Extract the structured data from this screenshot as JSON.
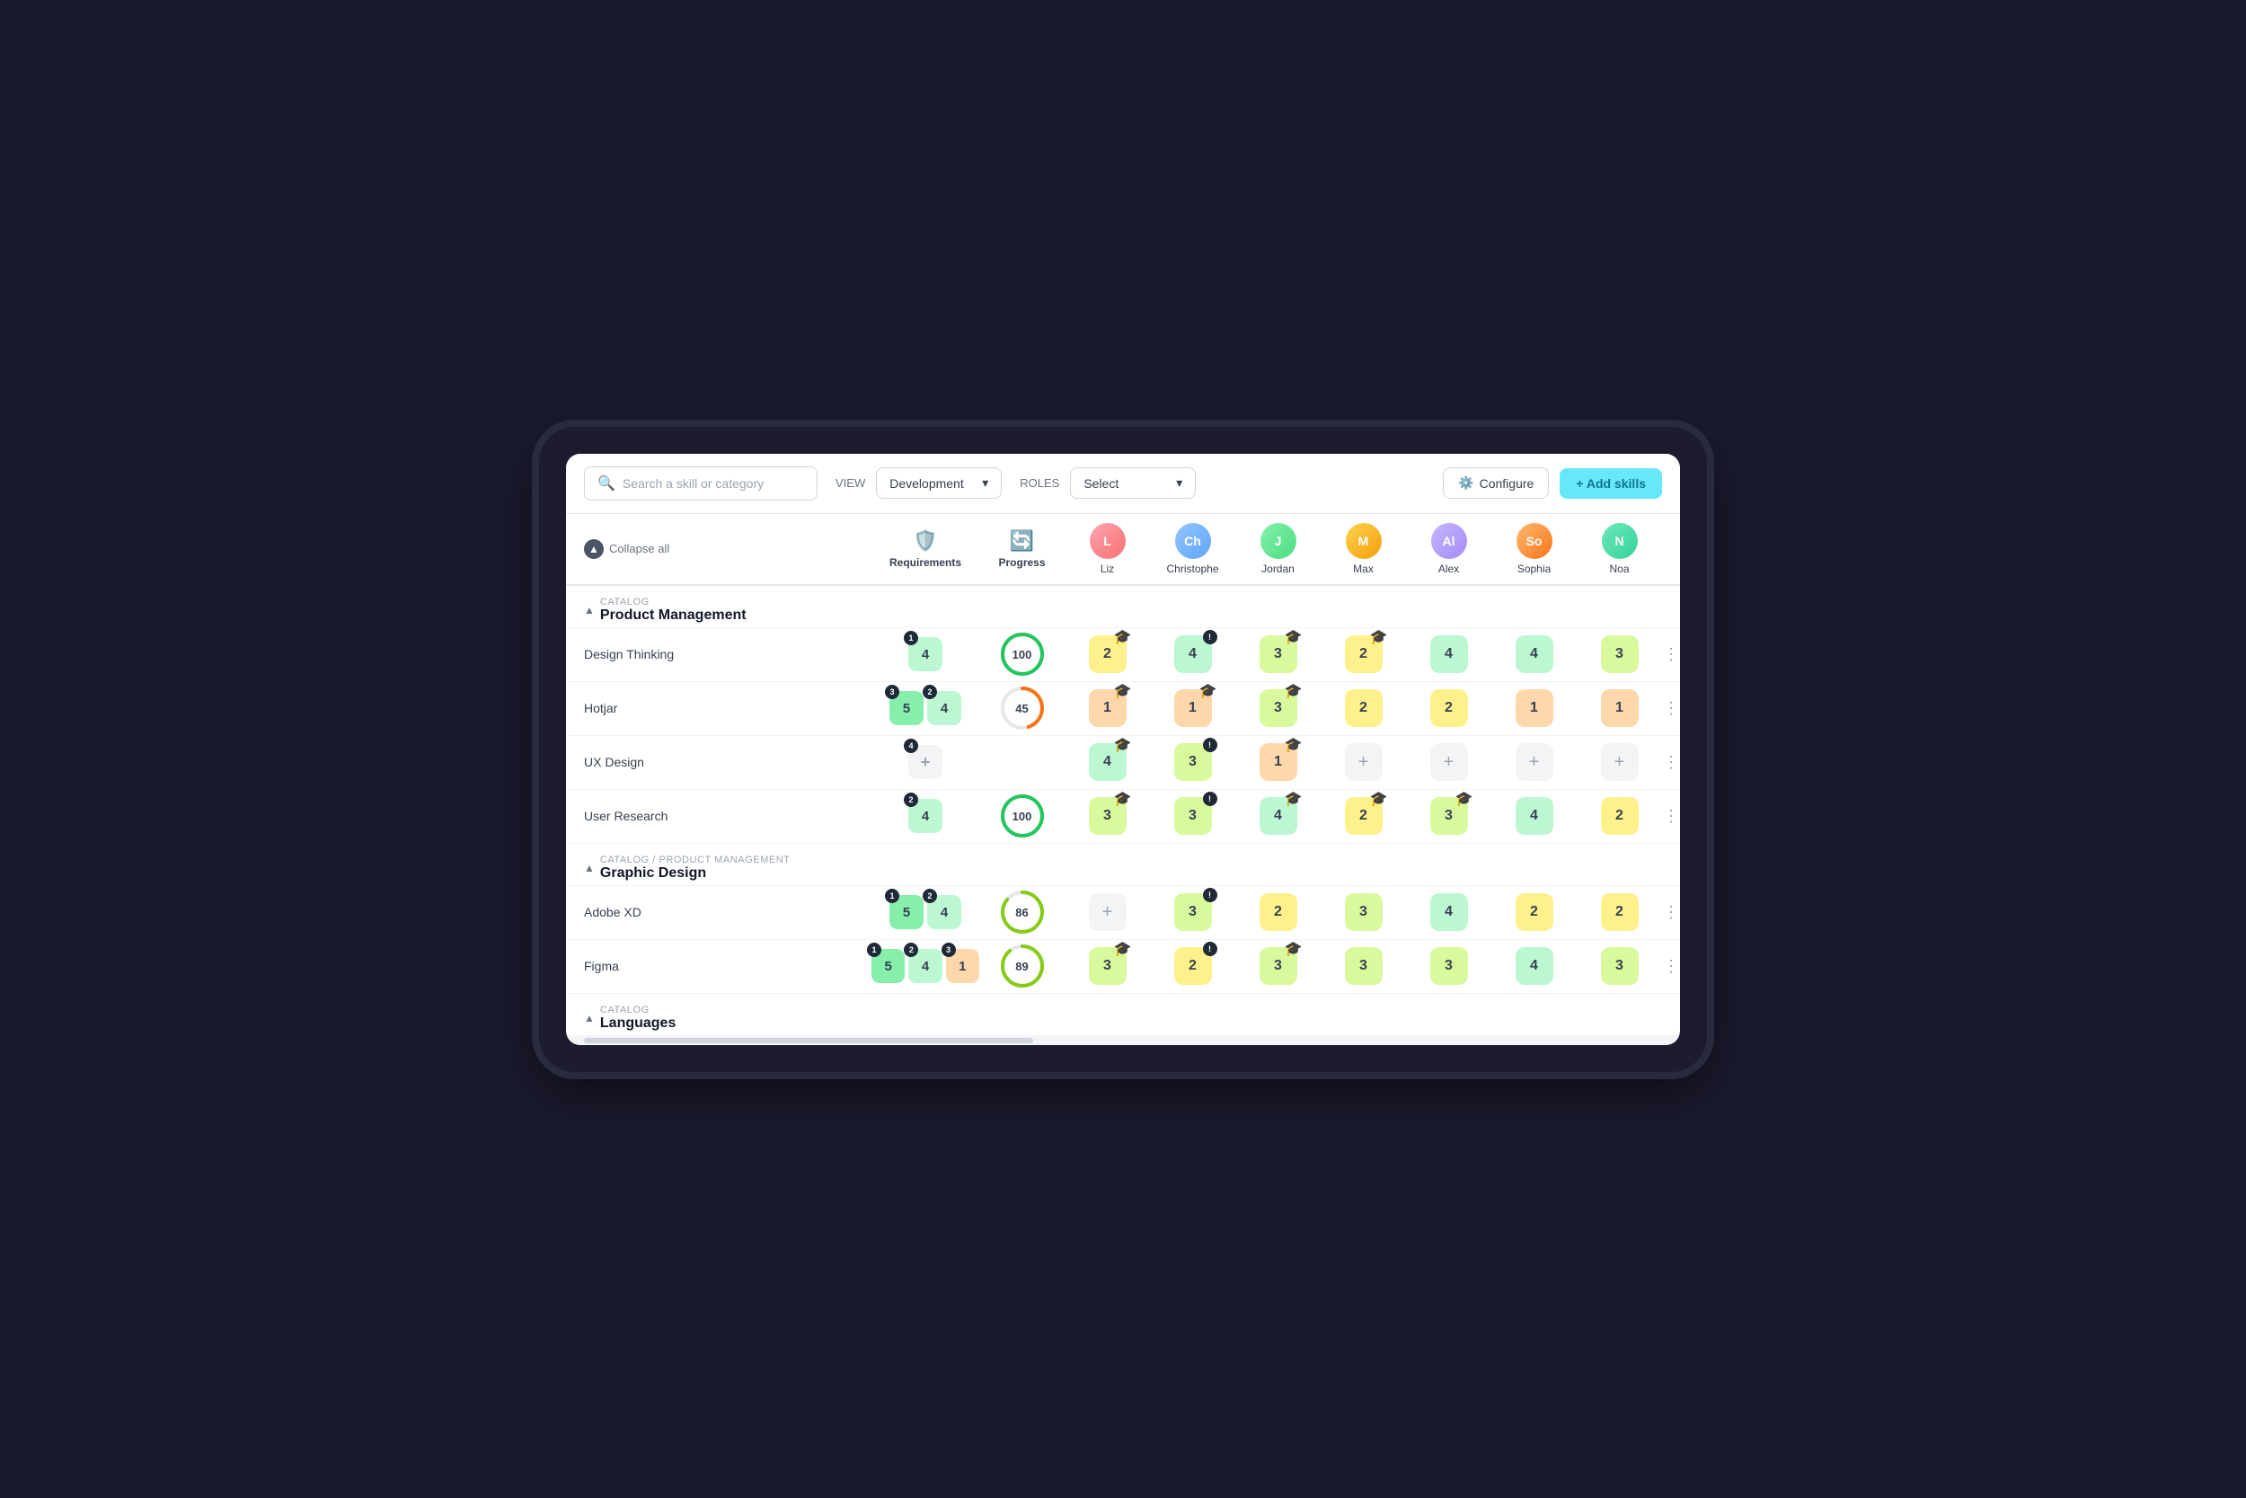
{
  "toolbar": {
    "search_placeholder": "Search a skill or category",
    "view_label": "VIEW",
    "view_value": "Development",
    "roles_label": "ROLES",
    "roles_value": "Select",
    "configure_label": "Configure",
    "add_skills_label": "+ Add skills"
  },
  "table": {
    "collapse_all_label": "Collapse all",
    "columns": {
      "requirements_label": "Requirements",
      "progress_label": "Progress"
    },
    "persons": [
      {
        "name": "Liz",
        "avatar_class": "avatar-liz",
        "initials": "L"
      },
      {
        "name": "Christophe",
        "avatar_class": "avatar-chris",
        "initials": "Ch"
      },
      {
        "name": "Jordan",
        "avatar_class": "avatar-jordan",
        "initials": "J"
      },
      {
        "name": "Max",
        "avatar_class": "avatar-max",
        "initials": "M"
      },
      {
        "name": "Alex",
        "avatar_class": "avatar-alex",
        "initials": "Al"
      },
      {
        "name": "Sophia",
        "avatar_class": "avatar-sophia",
        "initials": "So"
      },
      {
        "name": "Noa",
        "avatar_class": "avatar-noa",
        "initials": "N"
      }
    ],
    "sections": [
      {
        "catalog": "Catalog",
        "title": "Product Management",
        "skills": [
          {
            "name": "Design Thinking",
            "req1": {
              "value": "4",
              "count": "1",
              "color": "score-4"
            },
            "progress": 100,
            "progress_color": "#22c55e",
            "scores": [
              {
                "value": "2",
                "type": "grad",
                "color": "score-2"
              },
              {
                "value": "4",
                "type": "warn",
                "color": "score-4"
              },
              {
                "value": "3",
                "type": "grad",
                "color": "score-3"
              },
              {
                "value": "2",
                "type": "grad",
                "color": "score-2"
              },
              {
                "value": "4",
                "type": "none",
                "color": "score-4"
              },
              {
                "value": "4",
                "type": "none",
                "color": "score-4"
              },
              {
                "value": "3",
                "type": "none",
                "color": "score-3"
              }
            ]
          },
          {
            "name": "Hotjar",
            "req1": {
              "value": "5",
              "count": "3",
              "color": "score-5"
            },
            "req2": {
              "value": "4",
              "count": "2",
              "color": "score-4"
            },
            "progress": 45,
            "progress_color": "#f97316",
            "scores": [
              {
                "value": "1",
                "type": "grad",
                "color": "score-1"
              },
              {
                "value": "1",
                "type": "grad",
                "color": "score-1"
              },
              {
                "value": "3",
                "type": "grad",
                "color": "score-3"
              },
              {
                "value": "2",
                "type": "none",
                "color": "score-2"
              },
              {
                "value": "2",
                "type": "none",
                "color": "score-2"
              },
              {
                "value": "1",
                "type": "none",
                "color": "score-1"
              },
              {
                "value": "1",
                "type": "none",
                "color": "score-1"
              }
            ]
          },
          {
            "name": "UX Design",
            "req1": {
              "value": "+",
              "count": "4",
              "color": "plus"
            },
            "progress": null,
            "scores": [
              {
                "value": "4",
                "type": "grad",
                "color": "score-4"
              },
              {
                "value": "3",
                "type": "warn",
                "color": "score-3"
              },
              {
                "value": "1",
                "type": "grad",
                "color": "score-1"
              },
              {
                "value": "+",
                "type": "none",
                "color": "plus"
              },
              {
                "value": "+",
                "type": "none",
                "color": "plus"
              },
              {
                "value": "+",
                "type": "none",
                "color": "plus"
              },
              {
                "value": "+",
                "type": "none",
                "color": "plus"
              }
            ]
          },
          {
            "name": "User Research",
            "req1": {
              "value": "4",
              "count": "2",
              "color": "score-4"
            },
            "progress": 100,
            "progress_color": "#22c55e",
            "scores": [
              {
                "value": "3",
                "type": "grad",
                "color": "score-3"
              },
              {
                "value": "3",
                "type": "warn",
                "color": "score-3"
              },
              {
                "value": "4",
                "type": "grad",
                "color": "score-4"
              },
              {
                "value": "2",
                "type": "grad",
                "color": "score-2"
              },
              {
                "value": "3",
                "type": "grad",
                "color": "score-3"
              },
              {
                "value": "4",
                "type": "none",
                "color": "score-4"
              },
              {
                "value": "2",
                "type": "none",
                "color": "score-2"
              }
            ]
          }
        ]
      },
      {
        "catalog": "Catalog / Product Management",
        "title": "Graphic Design",
        "skills": [
          {
            "name": "Adobe XD",
            "req1": {
              "value": "5",
              "count": "1",
              "color": "score-5"
            },
            "req2": {
              "value": "4",
              "count": "2",
              "color": "score-4"
            },
            "progress": 86,
            "progress_color": "#84cc16",
            "scores": [
              {
                "value": "+",
                "type": "none",
                "color": "plus"
              },
              {
                "value": "3",
                "type": "warn",
                "color": "score-3"
              },
              {
                "value": "2",
                "type": "none",
                "color": "score-2"
              },
              {
                "value": "3",
                "type": "none",
                "color": "score-3"
              },
              {
                "value": "4",
                "type": "none",
                "color": "score-4"
              },
              {
                "value": "2",
                "type": "none",
                "color": "score-2"
              },
              {
                "value": "2",
                "type": "none",
                "color": "score-2"
              }
            ]
          },
          {
            "name": "Figma",
            "req1": {
              "value": "5",
              "count": "1",
              "color": "score-5"
            },
            "req2": {
              "value": "4",
              "count": "2",
              "color": "score-4"
            },
            "req3": {
              "value": "1",
              "count": "3",
              "color": "score-1"
            },
            "progress": 89,
            "progress_color": "#84cc16",
            "scores": [
              {
                "value": "3",
                "type": "grad",
                "color": "score-3"
              },
              {
                "value": "2",
                "type": "warn",
                "color": "score-2"
              },
              {
                "value": "3",
                "type": "grad",
                "color": "score-3"
              },
              {
                "value": "3",
                "type": "none",
                "color": "score-3"
              },
              {
                "value": "3",
                "type": "none",
                "color": "score-3"
              },
              {
                "value": "4",
                "type": "none",
                "color": "score-4"
              },
              {
                "value": "3",
                "type": "none",
                "color": "score-3"
              }
            ]
          }
        ]
      },
      {
        "catalog": "Catalog",
        "title": "Languages",
        "skills": []
      }
    ]
  }
}
